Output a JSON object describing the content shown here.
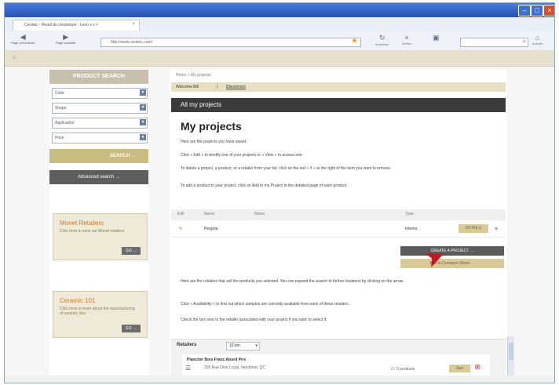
{
  "window": {
    "title": "",
    "tab_title": "Ceratec - Retail du céramique - Leno x x ×",
    "tab_close": "×",
    "address": "http://www.ceratec.com/",
    "back_label": "Page précédente",
    "forward_label": "Page suivante",
    "refresh_label": "Actualiser",
    "stop_label": "Arrêter",
    "home_label": "Accueil",
    "search_placeholder": ""
  },
  "sidebar": {
    "title": "PRODUCT SEARCH",
    "filters": [
      {
        "label": "Color"
      },
      {
        "label": "Shape"
      },
      {
        "label": "Application"
      },
      {
        "label": "Price"
      }
    ],
    "search_button": "SEARCH",
    "advanced_button": "Advanced search"
  },
  "promos": [
    {
      "title": "Monet Retailers",
      "text": "Click here to view our Monet retailers",
      "button": "GO"
    },
    {
      "title": "Ceramic 101",
      "text": "Click here to learn about the manufacturing of ceramic tiles",
      "button": "GO"
    }
  ],
  "main": {
    "breadcrumb": "Home > My projects",
    "subtabs": [
      "Welcome Bill",
      "Disconnect"
    ],
    "section_title": "All my projects",
    "page_title": "My projects",
    "paragraphs": [
      "Here are the projects you have saved.",
      "Click « Edit » to modify one of your projects or « View » to access one.",
      "To delete a project, a product, or a retailer from your list, click on the red « X » to the right of the item you want to remove.",
      "To add a product to your project, click on Add to my Project in the detailed page of each product."
    ],
    "table": {
      "headers": [
        "Edit",
        "Name",
        "Notes",
        "Type"
      ],
      "row": {
        "name": "Pergola",
        "type": "Interior",
        "details": "DETAILS"
      }
    },
    "buttons": {
      "create": "CREATE A PROJECT",
      "compare": "Add to Compare Sheet"
    },
    "retailer_text": [
      "Here are the retailers that sell the products you selected. You can expand the search to further locations by clicking on the arrow.",
      "Click « Availability » to find out which samples are currently available from each of these retailers.",
      "Check the box next to the retailer associated with your project if you wish to select it."
    ],
    "retailers": {
      "label": "Retailers",
      "radius": "10 km",
      "card": {
        "name": "Plancher Bois Franc Abord Prix",
        "address": "205 Rue Dion Loyal, Vendôme, QC",
        "count": "2 / 3 products",
        "button": "See"
      }
    }
  }
}
